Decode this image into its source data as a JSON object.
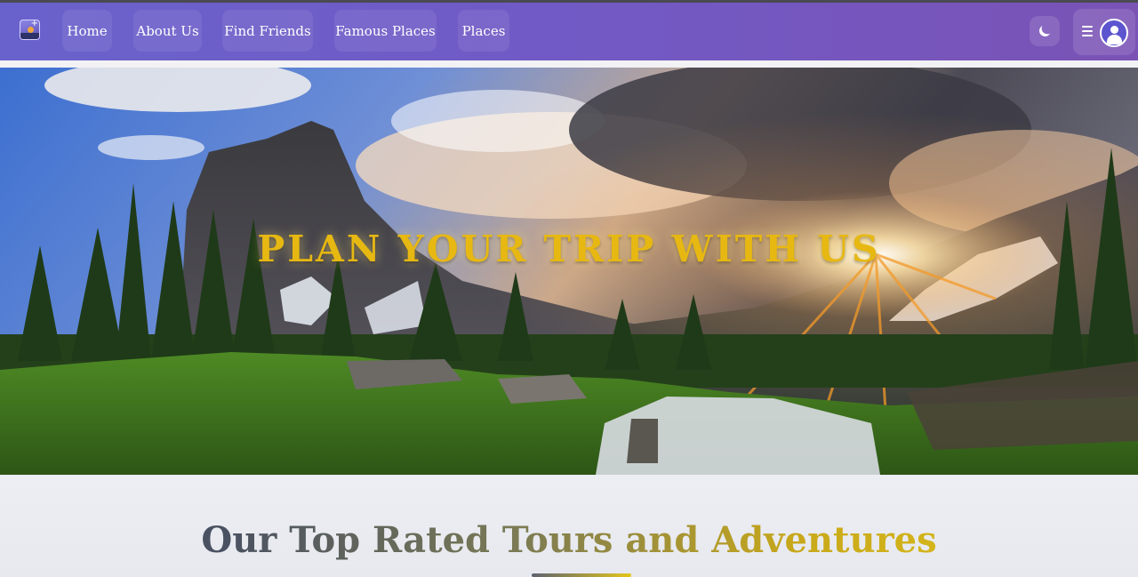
{
  "nav": {
    "logo_icon": "travel-logo-icon",
    "links": [
      {
        "label": "Home"
      },
      {
        "label": "About Us"
      },
      {
        "label": "Find Friends"
      },
      {
        "label": "Famous Places"
      },
      {
        "label": "Places"
      }
    ],
    "theme_toggle_icon": "moon-icon",
    "menu_icon": "hamburger-icon",
    "avatar_icon": "user-icon"
  },
  "hero": {
    "title": "PLAN YOUR TRIP WITH US"
  },
  "section": {
    "title": "Our Top Rated Tours and Adventures"
  },
  "colors": {
    "nav_gradient_start": "#6a62cc",
    "nav_gradient_end": "#7a53b5",
    "hero_title": "#e7b812",
    "section_title_start": "#4a5262",
    "section_title_end": "#e4c61a"
  }
}
